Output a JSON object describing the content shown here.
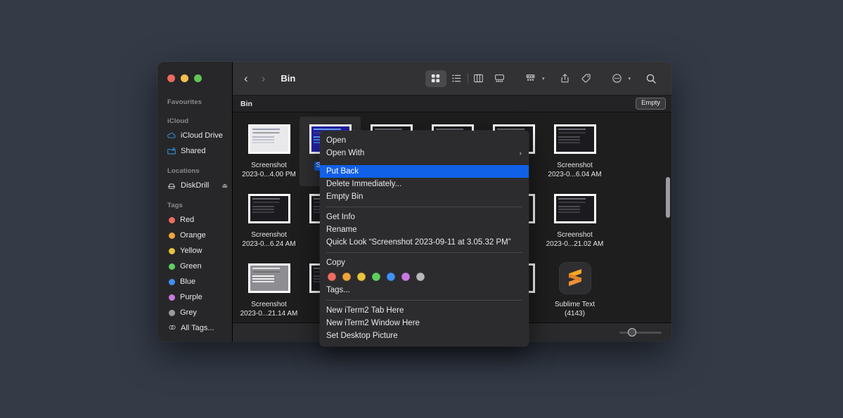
{
  "window": {
    "title": "Bin",
    "traffic_lights": [
      "close",
      "minimize",
      "zoom"
    ]
  },
  "toolbar": {
    "back_label": "‹",
    "forward_label": "›",
    "view_icon_grid": "icon-view-icon",
    "view_list": "list-view-icon",
    "view_column": "column-view-icon",
    "view_gallery": "gallery-view-icon",
    "group_by": "group-by-icon",
    "share": "share-icon",
    "tag": "tag-icon",
    "actions": "more-actions-icon",
    "search": "search-icon",
    "caret": "▾"
  },
  "pathbar": {
    "location": "Bin",
    "empty_label": "Empty"
  },
  "sidebar": {
    "groups": [
      {
        "title": "Favourites",
        "items": []
      },
      {
        "title": "iCloud",
        "items": [
          {
            "label": "iCloud Drive",
            "icon": "cloud-icon"
          },
          {
            "label": "Shared",
            "icon": "shared-folder-icon"
          }
        ]
      },
      {
        "title": "Locations",
        "items": [
          {
            "label": "DiskDrill",
            "icon": "hard-drive-icon",
            "eject": "⏏"
          }
        ]
      }
    ],
    "tags_title": "Tags",
    "tags": [
      {
        "label": "Red",
        "color": "#ec6d5e"
      },
      {
        "label": "Orange",
        "color": "#f0a33c"
      },
      {
        "label": "Yellow",
        "color": "#e8c33e"
      },
      {
        "label": "Green",
        "color": "#5ece5e"
      },
      {
        "label": "Blue",
        "color": "#3f92f5"
      },
      {
        "label": "Purple",
        "color": "#c97ae0"
      },
      {
        "label": "Grey",
        "color": "#9a9a9e"
      }
    ],
    "all_tags": {
      "label": "All Tags...",
      "icon": "all-tags-icon"
    }
  },
  "files": [
    {
      "line1": "Screenshot",
      "line2": "2023-0...4.00 PM",
      "thumb": "light",
      "selected": false
    },
    {
      "line1": "Sc",
      "line2": "2023",
      "thumb": "blue",
      "selected": true
    },
    {
      "line1": "Screenshot",
      "line2": "2023-0...",
      "thumb": "dark",
      "selected": false
    },
    {
      "line1": "Screenshot",
      "line2": "2023-0...",
      "thumb": "dark",
      "selected": false
    },
    {
      "line1": "ot",
      "line2": "AM",
      "thumb": "dark",
      "selected": false
    },
    {
      "line1": "Screenshot",
      "line2": "2023-0...6.04 AM",
      "thumb": "dark",
      "selected": false
    },
    {
      "line1": "Screenshot",
      "line2": "2023-0...6.24 AM",
      "thumb": "dark",
      "selected": false
    },
    {
      "line1": "Sc",
      "line2": "2023",
      "thumb": "dark",
      "selected": false
    },
    {
      "line1": "",
      "line2": "",
      "thumb": "dark",
      "selected": false
    },
    {
      "line1": "",
      "line2": "",
      "thumb": "dark",
      "selected": false
    },
    {
      "line1": "ot",
      "line2": "AM",
      "thumb": "dark",
      "selected": false
    },
    {
      "line1": "Screenshot",
      "line2": "2023-0...21.02 AM",
      "thumb": "dark",
      "selected": false
    },
    {
      "line1": "Screenshot",
      "line2": "2023-0...21.14 AM",
      "thumb": "grey",
      "selected": false
    },
    {
      "line1": "Sc",
      "line2": "2023",
      "thumb": "dark",
      "selected": false
    },
    {
      "line1": "",
      "line2": "",
      "thumb": "dark",
      "selected": false
    },
    {
      "line1": "",
      "line2": "",
      "thumb": "dark",
      "selected": false
    },
    {
      "line1": "g",
      "line2": "",
      "thumb": "dark",
      "selected": false
    },
    {
      "line1": "Sublime Text",
      "line2": "(4143)",
      "thumb": "app",
      "selected": false
    }
  ],
  "context_menu": {
    "items": [
      {
        "label": "Open",
        "type": "item"
      },
      {
        "label": "Open With",
        "type": "submenu",
        "arrow": "›"
      },
      {
        "type": "gap"
      },
      {
        "label": "Put Back",
        "type": "item",
        "highlighted": true
      },
      {
        "label": "Delete Immediately...",
        "type": "item"
      },
      {
        "label": "Empty Bin",
        "type": "item"
      },
      {
        "type": "separator"
      },
      {
        "label": "Get Info",
        "type": "item"
      },
      {
        "label": "Rename",
        "type": "item"
      },
      {
        "label": "Quick Look “Screenshot 2023-09-11 at 3.05.32 PM”",
        "type": "item"
      },
      {
        "type": "separator"
      },
      {
        "label": "Copy",
        "type": "item"
      },
      {
        "type": "tagcolors"
      },
      {
        "label": "Tags...",
        "type": "item"
      },
      {
        "type": "separator"
      },
      {
        "label": "New iTerm2 Tab Here",
        "type": "item"
      },
      {
        "label": "New iTerm2 Window Here",
        "type": "item"
      },
      {
        "label": "Set Desktop Picture",
        "type": "item"
      }
    ],
    "tag_colors": [
      "#ec6d5e",
      "#f0a33c",
      "#e8c33e",
      "#5ece5e",
      "#3f92f5",
      "#c97ae0",
      "#b8b8bc"
    ]
  },
  "statusbar": {
    "zoom_slider_value": 20
  },
  "colors": {
    "accent": "#1160e8",
    "desktop_bg": "#333b47",
    "window_bg": "#1e1e1e",
    "sidebar_bg": "#272729",
    "menu_bg": "#2c2c2e"
  }
}
